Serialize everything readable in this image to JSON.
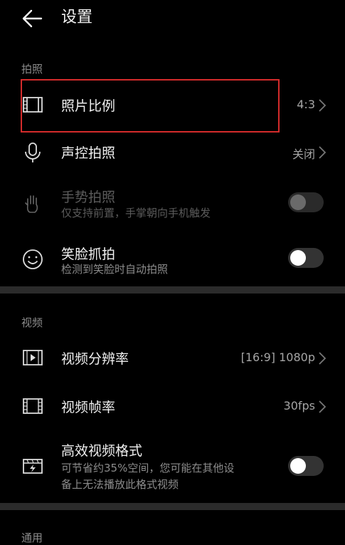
{
  "header": {
    "title": "设置",
    "back_icon": "arrow-left-icon"
  },
  "sections": {
    "photo": "拍照",
    "video": "视频",
    "general": "通用"
  },
  "rows": {
    "photo_ratio": {
      "label": "照片比例",
      "value": "4:3",
      "icon": "film-frame-icon"
    },
    "voice_shot": {
      "label": "声控拍照",
      "value": "关闭",
      "icon": "microphone-icon"
    },
    "gesture_shot": {
      "label": "手势拍照",
      "sub": "仅支持前置，手掌朝向手机触发",
      "icon": "hand-icon",
      "toggle": false,
      "disabled": true
    },
    "smile_shot": {
      "label": "笑脸抓拍",
      "sub": "检测到笑脸时自动拍照",
      "icon": "smile-icon",
      "toggle": false
    },
    "video_resolution": {
      "label": "视频分辨率",
      "value": "[16:9] 1080p",
      "icon": "video-play-icon"
    },
    "video_framerate": {
      "label": "视频帧率",
      "value": "30fps",
      "icon": "film-strip-icon"
    },
    "hevc": {
      "label": "高效视频格式",
      "sub_line1": "可节省约35%空间，您可能在其他设",
      "sub_line2": "备上无法播放此格式视频",
      "icon": "film-flash-icon",
      "toggle": false
    }
  },
  "colors": {
    "highlight": "#d42b2b",
    "background": "#000000"
  }
}
